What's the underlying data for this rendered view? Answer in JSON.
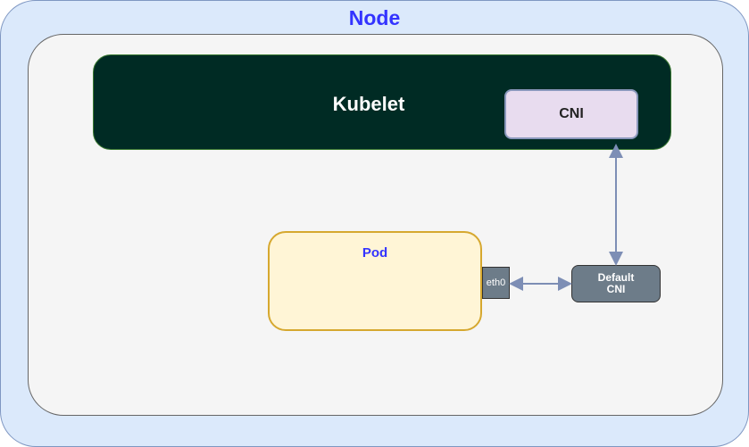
{
  "node": {
    "title": "Node"
  },
  "kubelet": {
    "title": "Kubelet",
    "cni_label": "CNI"
  },
  "pod": {
    "title": "Pod",
    "interface_label": "eth0"
  },
  "default_cni": {
    "line1": "Default",
    "line2": "CNI"
  },
  "colors": {
    "node_bg": "#dbe9fb",
    "inner_bg": "#f5f5f5",
    "kubelet_bg": "#002b24",
    "cni_box_bg": "#e8dcef",
    "pod_bg": "#fff5d6",
    "small_box_bg": "#6d7c89",
    "title_blue": "#3333ff",
    "arrow_color": "#7d8eb5"
  }
}
